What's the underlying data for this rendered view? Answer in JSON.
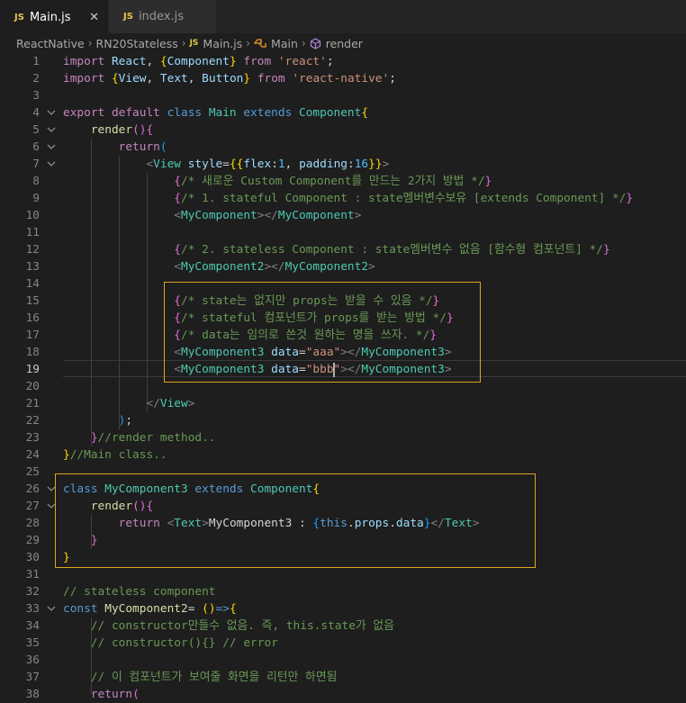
{
  "tabs": [
    {
      "label": "Main.js",
      "icon": "JS",
      "close": "✕",
      "active": true
    },
    {
      "label": "index.js",
      "icon": "JS",
      "active": false
    }
  ],
  "breadcrumb": [
    "ReactNative",
    "RN20Stateless",
    "Main.js",
    "Main",
    "render"
  ],
  "lines": [
    {
      "n": "1",
      "t": [
        [
          "kw2",
          "import "
        ],
        [
          "var",
          "React"
        ],
        [
          "pun",
          ", "
        ],
        [
          "br1",
          "{"
        ],
        [
          "var",
          "Component"
        ],
        [
          "br1",
          "}"
        ],
        [
          "kw2",
          " from "
        ],
        [
          "str",
          "'react'"
        ],
        [
          "pun",
          ";"
        ]
      ]
    },
    {
      "n": "2",
      "t": [
        [
          "kw2",
          "import "
        ],
        [
          "br1",
          "{"
        ],
        [
          "var",
          "View"
        ],
        [
          "pun",
          ", "
        ],
        [
          "var",
          "Text"
        ],
        [
          "pun",
          ", "
        ],
        [
          "var",
          "Button"
        ],
        [
          "br1",
          "}"
        ],
        [
          "kw2",
          " from "
        ],
        [
          "str",
          "'react-native'"
        ],
        [
          "pun",
          ";"
        ]
      ]
    },
    {
      "n": "3",
      "t": []
    },
    {
      "n": "4",
      "fold": true,
      "t": [
        [
          "kw2",
          "export "
        ],
        [
          "kw2",
          "default "
        ],
        [
          "kw",
          "class "
        ],
        [
          "cls",
          "Main "
        ],
        [
          "kw",
          "extends "
        ],
        [
          "cls",
          "Component"
        ],
        [
          "br1",
          "{"
        ]
      ]
    },
    {
      "n": "5",
      "fold": true,
      "t": [
        [
          "pun",
          "    "
        ],
        [
          "fn",
          "render"
        ],
        [
          "br2",
          "()"
        ],
        [
          "br2",
          "{"
        ]
      ]
    },
    {
      "n": "6",
      "fold": true,
      "t": [
        [
          "pun",
          "        "
        ],
        [
          "kw2",
          "return"
        ],
        [
          "br3",
          "("
        ]
      ]
    },
    {
      "n": "7",
      "fold": true,
      "t": [
        [
          "pun",
          "            "
        ],
        [
          "tag",
          "<"
        ],
        [
          "cls",
          "View "
        ],
        [
          "attr",
          "style"
        ],
        [
          "pun",
          "="
        ],
        [
          "br1",
          "{{"
        ],
        [
          "var",
          "flex"
        ],
        [
          "pun",
          ":"
        ],
        [
          "const",
          "1"
        ],
        [
          "pun",
          ", "
        ],
        [
          "var",
          "padding"
        ],
        [
          "pun",
          ":"
        ],
        [
          "const",
          "16"
        ],
        [
          "br1",
          "}}"
        ],
        [
          "tag",
          ">"
        ]
      ]
    },
    {
      "n": "8",
      "t": [
        [
          "pun",
          "                "
        ],
        [
          "br2",
          "{"
        ],
        [
          "cmt",
          "/* 새로운 Custom Component를 만드는 2가지 방법 */"
        ],
        [
          "br2",
          "}"
        ]
      ]
    },
    {
      "n": "9",
      "t": [
        [
          "pun",
          "                "
        ],
        [
          "br2",
          "{"
        ],
        [
          "cmt",
          "/* 1. stateful Component : state멤버변수보유 [extends Component] */"
        ],
        [
          "br2",
          "}"
        ]
      ]
    },
    {
      "n": "10",
      "t": [
        [
          "pun",
          "                "
        ],
        [
          "tag",
          "<"
        ],
        [
          "cls",
          "MyComponent"
        ],
        [
          "tag",
          "></"
        ],
        [
          "cls",
          "MyComponent"
        ],
        [
          "tag",
          ">"
        ]
      ]
    },
    {
      "n": "11",
      "t": []
    },
    {
      "n": "12",
      "t": [
        [
          "pun",
          "                "
        ],
        [
          "br2",
          "{"
        ],
        [
          "cmt",
          "/* 2. stateless Component : state멤버변수 없음 [함수형 컴포넌트] */"
        ],
        [
          "br2",
          "}"
        ]
      ]
    },
    {
      "n": "13",
      "t": [
        [
          "pun",
          "                "
        ],
        [
          "tag",
          "<"
        ],
        [
          "cls",
          "MyComponent2"
        ],
        [
          "tag",
          "></"
        ],
        [
          "cls",
          "MyComponent2"
        ],
        [
          "tag",
          ">"
        ]
      ]
    },
    {
      "n": "14",
      "t": []
    },
    {
      "n": "15",
      "t": [
        [
          "pun",
          "                "
        ],
        [
          "br2",
          "{"
        ],
        [
          "cmt",
          "/* state는 없지만 props는 받을 수 있음 */"
        ],
        [
          "br2",
          "}"
        ]
      ]
    },
    {
      "n": "16",
      "t": [
        [
          "pun",
          "                "
        ],
        [
          "br2",
          "{"
        ],
        [
          "cmt",
          "/* stateful 컴포넌트가 props를 받는 방법 */"
        ],
        [
          "br2",
          "}"
        ]
      ]
    },
    {
      "n": "17",
      "t": [
        [
          "pun",
          "                "
        ],
        [
          "br2",
          "{"
        ],
        [
          "cmt",
          "/* data는 임의로 쓴것 원하는 명을 쓰자. */"
        ],
        [
          "br2",
          "}"
        ]
      ]
    },
    {
      "n": "18",
      "t": [
        [
          "pun",
          "                "
        ],
        [
          "tag",
          "<"
        ],
        [
          "cls",
          "MyComponent3 "
        ],
        [
          "attr",
          "data"
        ],
        [
          "pun",
          "="
        ],
        [
          "str",
          "\"aaa\""
        ],
        [
          "tag",
          "></"
        ],
        [
          "cls",
          "MyComponent3"
        ],
        [
          "tag",
          ">"
        ]
      ]
    },
    {
      "n": "19",
      "cursor": true,
      "t": [
        [
          "pun",
          "                "
        ],
        [
          "tag",
          "<"
        ],
        [
          "cls",
          "MyComponent3 "
        ],
        [
          "attr",
          "data"
        ],
        [
          "pun",
          "="
        ],
        [
          "str",
          "\"bbb"
        ],
        [
          "caret",
          ""
        ],
        [
          "str",
          "\""
        ],
        [
          "tag",
          "></"
        ],
        [
          "cls",
          "MyComponent3"
        ],
        [
          "tag",
          ">"
        ]
      ]
    },
    {
      "n": "20",
      "t": []
    },
    {
      "n": "21",
      "t": [
        [
          "pun",
          "            "
        ],
        [
          "tag",
          "</"
        ],
        [
          "cls",
          "View"
        ],
        [
          "tag",
          ">"
        ]
      ]
    },
    {
      "n": "22",
      "t": [
        [
          "pun",
          "        "
        ],
        [
          "br3",
          ")"
        ],
        [
          "pun",
          ";"
        ]
      ]
    },
    {
      "n": "23",
      "t": [
        [
          "pun",
          "    "
        ],
        [
          "br2",
          "}"
        ],
        [
          "cmt",
          "//render method.."
        ]
      ]
    },
    {
      "n": "24",
      "t": [
        [
          "br1",
          "}"
        ],
        [
          "cmt",
          "//Main class.."
        ]
      ]
    },
    {
      "n": "25",
      "t": []
    },
    {
      "n": "26",
      "fold": true,
      "t": [
        [
          "kw",
          "class "
        ],
        [
          "cls",
          "MyComponent3 "
        ],
        [
          "kw",
          "extends "
        ],
        [
          "cls",
          "Component"
        ],
        [
          "br1",
          "{"
        ]
      ]
    },
    {
      "n": "27",
      "fold": true,
      "t": [
        [
          "pun",
          "    "
        ],
        [
          "fn",
          "render"
        ],
        [
          "br2",
          "()"
        ],
        [
          "br2",
          "{"
        ]
      ]
    },
    {
      "n": "28",
      "t": [
        [
          "pun",
          "        "
        ],
        [
          "kw2",
          "return "
        ],
        [
          "tag",
          "<"
        ],
        [
          "cls",
          "Text"
        ],
        [
          "tag",
          ">"
        ],
        [
          "pun",
          "MyComponent3 : "
        ],
        [
          "br3",
          "{"
        ],
        [
          "kw",
          "this"
        ],
        [
          "pun",
          "."
        ],
        [
          "var",
          "props"
        ],
        [
          "pun",
          "."
        ],
        [
          "var",
          "data"
        ],
        [
          "br3",
          "}"
        ],
        [
          "tag",
          "</"
        ],
        [
          "cls",
          "Text"
        ],
        [
          "tag",
          ">"
        ]
      ]
    },
    {
      "n": "29",
      "t": [
        [
          "pun",
          "    "
        ],
        [
          "br2",
          "}"
        ]
      ]
    },
    {
      "n": "30",
      "t": [
        [
          "br1",
          "}"
        ]
      ]
    },
    {
      "n": "31",
      "t": []
    },
    {
      "n": "32",
      "t": [
        [
          "cmt",
          "// stateless component"
        ]
      ]
    },
    {
      "n": "33",
      "fold": true,
      "t": [
        [
          "kw",
          "const "
        ],
        [
          "fn",
          "MyComponent2"
        ],
        [
          "pun",
          "= "
        ],
        [
          "br1",
          "()"
        ],
        [
          "kw",
          "=>"
        ],
        [
          "br1",
          "{"
        ]
      ]
    },
    {
      "n": "34",
      "t": [
        [
          "pun",
          "    "
        ],
        [
          "cmt",
          "// constructor만들수 없음. 즉, this.state가 없음"
        ]
      ]
    },
    {
      "n": "35",
      "t": [
        [
          "pun",
          "    "
        ],
        [
          "cmt",
          "// constructor(){} // error"
        ]
      ]
    },
    {
      "n": "36",
      "t": []
    },
    {
      "n": "37",
      "t": [
        [
          "pun",
          "    "
        ],
        [
          "cmt",
          "// 이 컴포넌트가 보여줄 화면을 리턴만 하면됨"
        ]
      ]
    },
    {
      "n": "38",
      "t": [
        [
          "pun",
          "    "
        ],
        [
          "kw2",
          "return"
        ],
        [
          "br2",
          "("
        ]
      ]
    }
  ]
}
